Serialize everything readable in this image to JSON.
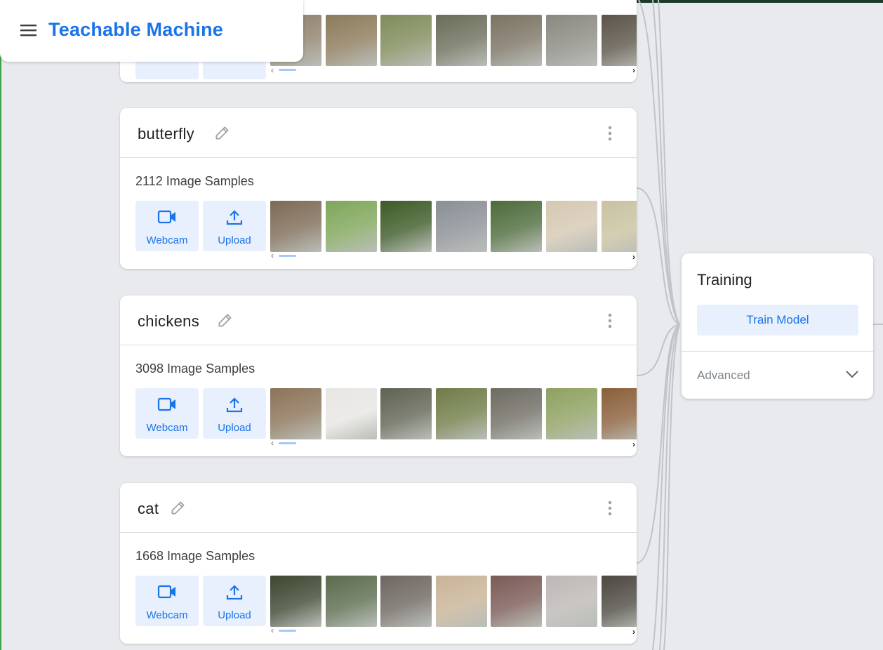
{
  "app": {
    "title": "Teachable Machine"
  },
  "classes": [
    {
      "name": "butterfly",
      "samples_label": "2112 Image Samples",
      "thumb_colors": [
        "#7d6a55",
        "#7fa65a",
        "#3c5a26",
        "#8a8f95",
        "#4d6b3a",
        "#d5c8b2",
        "#c9c2a0"
      ]
    },
    {
      "name": "chickens",
      "samples_label": "3098 Image Samples",
      "thumb_colors": [
        "#8b7358",
        "#e8e6e3",
        "#5f6352",
        "#6f7c47",
        "#6e6b62",
        "#8ea160",
        "#8a5f3a"
      ]
    },
    {
      "name": "cat",
      "samples_label": "1668 Image Samples",
      "thumb_colors": [
        "#3c4630",
        "#5b6b4d",
        "#6d6660",
        "#c8b397",
        "#7a5a56",
        "#bdb8b5",
        "#4d4841"
      ]
    }
  ],
  "top_card": {
    "thumb_colors": [
      "#8d7f6a",
      "#8c7a5a",
      "#7f8b5a",
      "#6b6d5a",
      "#7a7262",
      "#8a8880",
      "#5a5448"
    ]
  },
  "buttons": {
    "webcam": "Webcam",
    "upload": "Upload"
  },
  "training": {
    "title": "Training",
    "train_button": "Train Model",
    "advanced_label": "Advanced"
  },
  "colors": {
    "accent": "#1a73e8",
    "button_bg": "#e8f0fe",
    "page_bg": "#e8eaed"
  },
  "icons": [
    "menu-icon",
    "pencil-icon",
    "more-vert-icon",
    "videocam-icon",
    "upload-icon",
    "chevron-down-icon"
  ]
}
